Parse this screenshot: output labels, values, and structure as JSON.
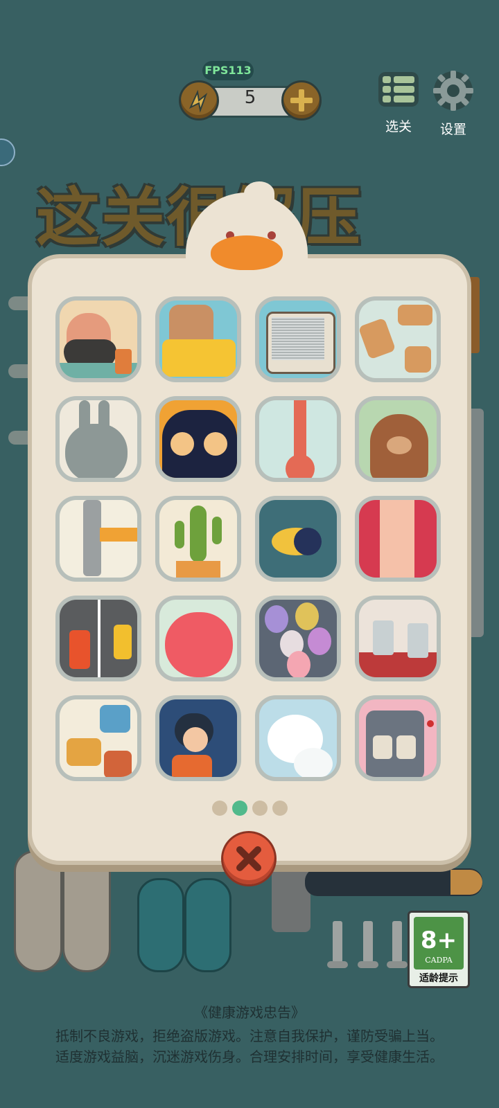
{
  "hud": {
    "fps": "FPS113",
    "energy_count": "5",
    "level_select_label": "选关",
    "settings_label": "设置"
  },
  "title": "这关很解压",
  "panel": {
    "levels": [
      {
        "name": "beard-man"
      },
      {
        "name": "toaster"
      },
      {
        "name": "tv"
      },
      {
        "name": "wood-screws"
      },
      {
        "name": "rabbit"
      },
      {
        "name": "black-cat"
      },
      {
        "name": "thermometer"
      },
      {
        "name": "bear"
      },
      {
        "name": "hammer"
      },
      {
        "name": "cactus"
      },
      {
        "name": "fish"
      },
      {
        "name": "hairy-leg"
      },
      {
        "name": "cars"
      },
      {
        "name": "apple"
      },
      {
        "name": "balloons"
      },
      {
        "name": "cups"
      },
      {
        "name": "puzzle"
      },
      {
        "name": "girl-umbrella"
      },
      {
        "name": "snowball"
      },
      {
        "name": "slot-machine"
      }
    ],
    "page_count": 4,
    "current_page": 2
  },
  "age_rating": {
    "value": "8+",
    "org": "CADPA",
    "label": "适龄提示"
  },
  "health_notice": {
    "title": "《健康游戏忠告》",
    "line1": "抵制不良游戏，拒绝盗版游戏。注意自我保护，谨防受骗上当。",
    "line2": "适度游戏益脑，沉迷游戏伤身。合理安排时间，享受健康生活。"
  },
  "colors": {
    "background": "#386062",
    "panel": "#ece3d3",
    "active_dot": "#51b98b",
    "close": "#e45c3e"
  }
}
